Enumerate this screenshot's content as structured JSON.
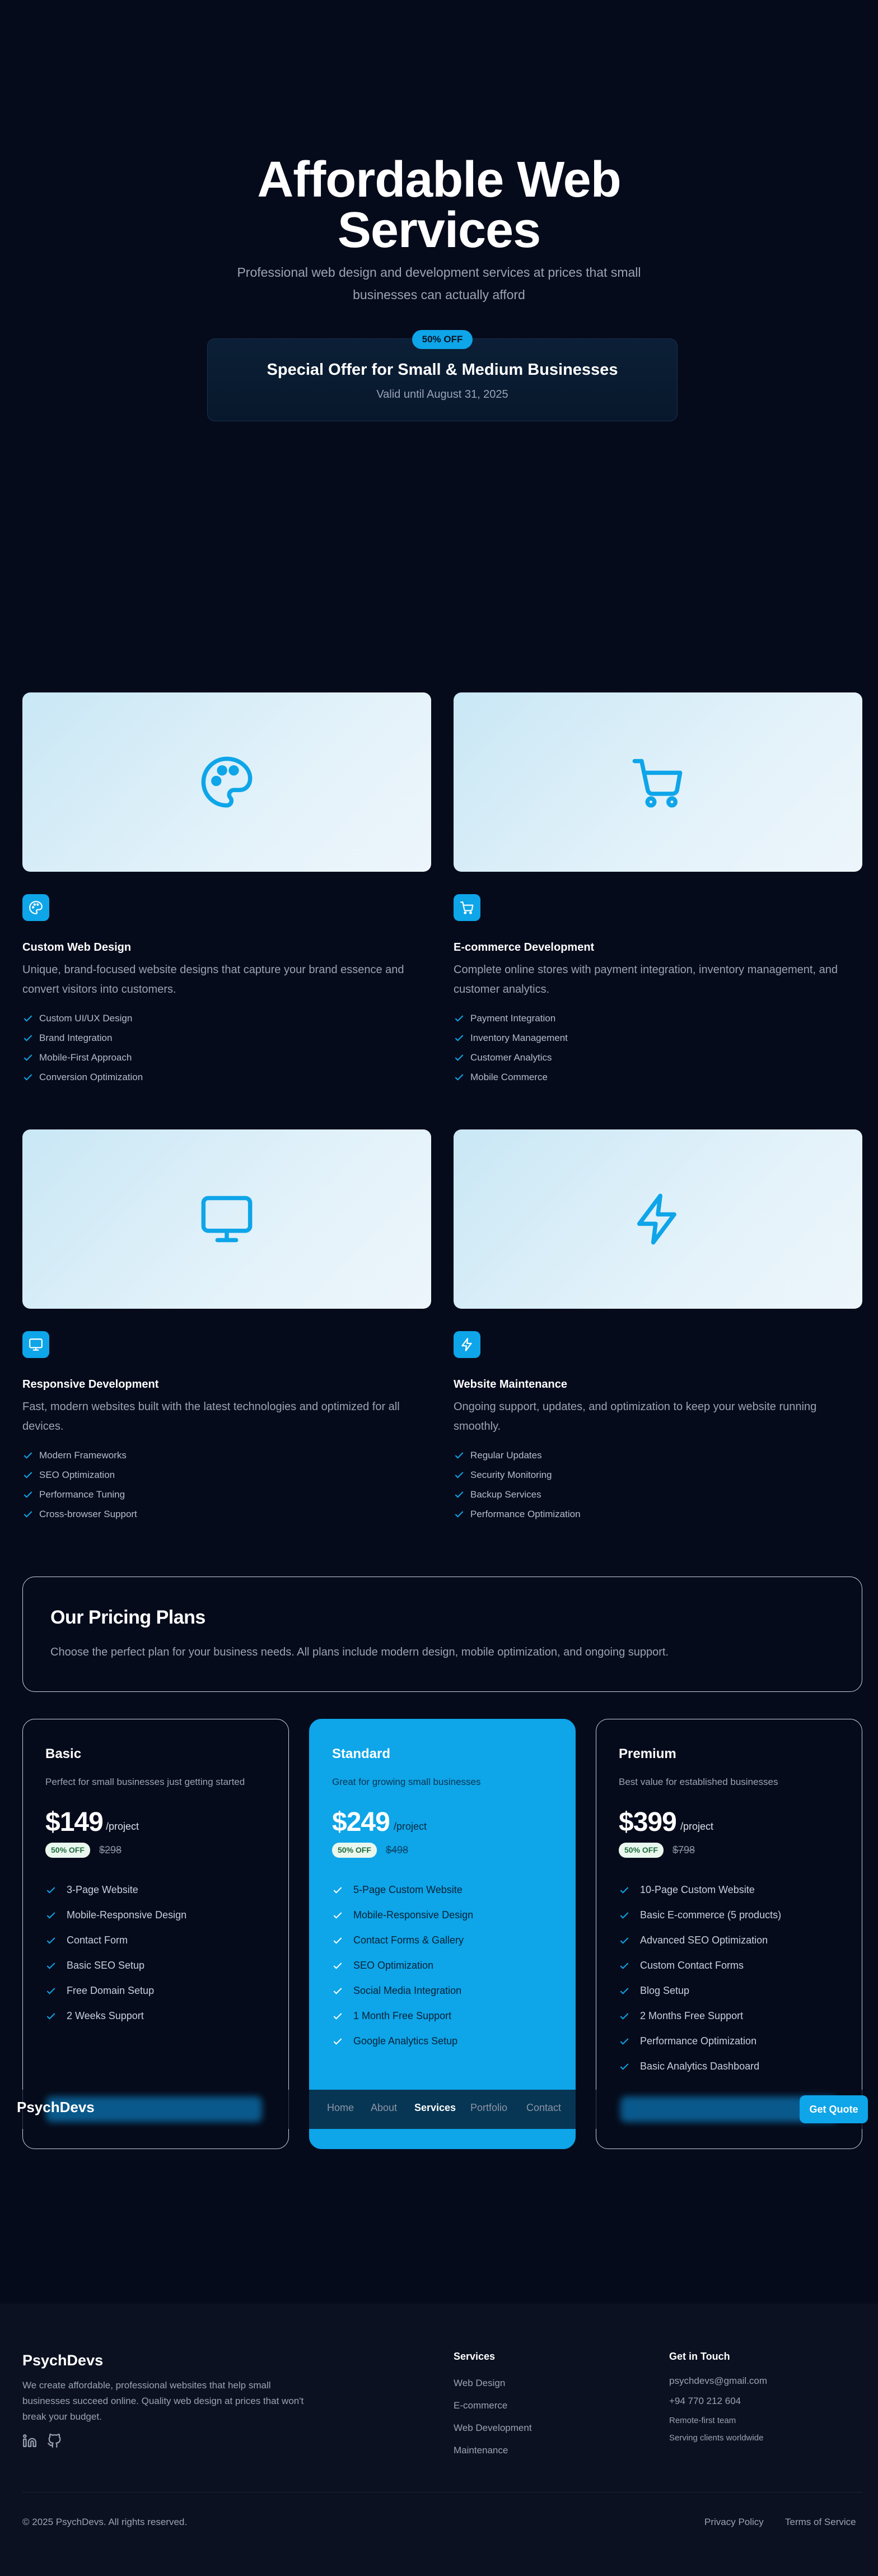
{
  "hero": {
    "title_line1": "Affordable Web",
    "title_line2": "Services",
    "subtitle_line1": "Professional web design and development services at prices that small",
    "subtitle_line2": "businesses can actually afford",
    "offer_badge": "50% OFF",
    "offer_title": "Special Offer for Small & Medium Businesses",
    "offer_valid": "Valid until August 31, 2025"
  },
  "services": [
    {
      "icon": "palette-icon",
      "title": "Custom Web Design",
      "desc_line1": "Unique, brand-focused website designs that capture your brand essence and",
      "desc_line2": "convert visitors into customers.",
      "features": [
        "Custom UI/UX Design",
        "Brand Integration",
        "Mobile-First Approach",
        "Conversion Optimization"
      ]
    },
    {
      "icon": "cart-icon",
      "title": "E-commerce Development",
      "desc_line1": "Complete online stores with payment integration, inventory management, and",
      "desc_line2": "customer analytics.",
      "features": [
        "Payment Integration",
        "Inventory Management",
        "Customer Analytics",
        "Mobile Commerce"
      ]
    },
    {
      "icon": "monitor-icon",
      "title": "Responsive Development",
      "desc_line1": "Fast, modern websites built with the latest technologies and optimized for all",
      "desc_line2": "devices.",
      "features": [
        "Modern Frameworks",
        "SEO Optimization",
        "Performance Tuning",
        "Cross-browser Support"
      ]
    },
    {
      "icon": "lightning-icon",
      "title": "Website Maintenance",
      "desc_line1": "Ongoing support, updates, and optimization to keep your website running",
      "desc_line2": "smoothly.",
      "features": [
        "Regular Updates",
        "Security Monitoring",
        "Backup Services",
        "Performance Optimization"
      ]
    }
  ],
  "pricing": {
    "title": "Our Pricing Plans",
    "subtitle": "Choose the perfect plan for your business needs. All plans include modern design, mobile optimization, and ongoing support.",
    "plans": [
      {
        "name": "Basic",
        "tagline": "Perfect for small businesses just getting started",
        "price": "$149",
        "per": "/project",
        "off": "50% OFF",
        "old_price": "$298",
        "features": [
          "3-Page Website",
          "Mobile-Responsive Design",
          "Contact Form",
          "Basic SEO Setup",
          "Free Domain Setup",
          "2 Weeks Support"
        ]
      },
      {
        "name": "Standard",
        "tagline": "Great for growing small businesses",
        "price": "$249",
        "per": "/project",
        "off": "50% OFF",
        "old_price": "$498",
        "features": [
          "5-Page Custom Website",
          "Mobile-Responsive Design",
          "Contact Forms & Gallery",
          "SEO Optimization",
          "Social Media Integration",
          "1 Month Free Support",
          "Google Analytics Setup"
        ]
      },
      {
        "name": "Premium",
        "tagline": "Best value for established businesses",
        "price": "$399",
        "per": "/project",
        "off": "50% OFF",
        "old_price": "$798",
        "features": [
          "10-Page Custom Website",
          "Basic E-commerce (5 products)",
          "Advanced SEO Optimization",
          "Custom Contact Forms",
          "Blog Setup",
          "2 Months Free Support",
          "Performance Optimization",
          "Basic Analytics Dashboard"
        ]
      }
    ]
  },
  "nav": {
    "brand": "PsychDevs",
    "links": [
      "Home",
      "About",
      "Services",
      "Portfolio",
      "Contact"
    ],
    "active": "Services",
    "cta": "Get Quote"
  },
  "footer": {
    "brand": "PsychDevs",
    "desc_line1": "We create affordable, professional websites that help small",
    "desc_line2": "businesses succeed online. Quality web design at prices that won't",
    "desc_line3": "break your budget.",
    "social": [
      "linkedin-icon",
      "github-icon"
    ],
    "services_title": "Services",
    "services_links": [
      "Web Design",
      "E-commerce",
      "Web Development",
      "Maintenance"
    ],
    "contact_title": "Get in Touch",
    "email": "psychdevs@gmail.com",
    "phone": "+94 770 212 604",
    "remote": "Remote-first team",
    "serving": "Serving clients worldwide",
    "copyright": "© 2025 PsychDevs. All rights reserved.",
    "privacy": "Privacy Policy",
    "terms": "Terms of Service"
  },
  "colors": {
    "background": "#060b1b",
    "accent": "#0ea5e9",
    "footer_bg": "#0b1120",
    "muted_text": "#9aa3b5"
  }
}
